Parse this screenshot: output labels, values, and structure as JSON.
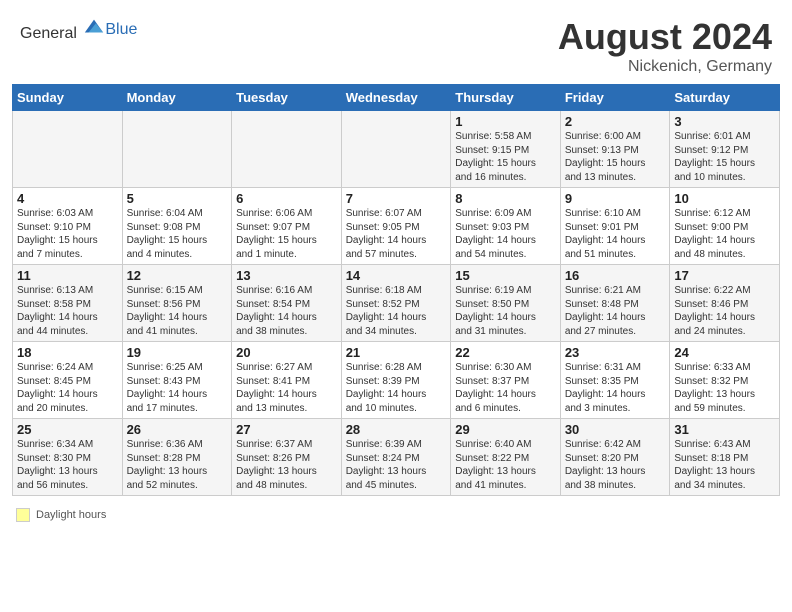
{
  "header": {
    "logo_general": "General",
    "logo_blue": "Blue",
    "month_year": "August 2024",
    "location": "Nickenich, Germany"
  },
  "footer": {
    "label": "Daylight hours"
  },
  "days_of_week": [
    "Sunday",
    "Monday",
    "Tuesday",
    "Wednesday",
    "Thursday",
    "Friday",
    "Saturday"
  ],
  "weeks": [
    [
      {
        "num": "",
        "info": ""
      },
      {
        "num": "",
        "info": ""
      },
      {
        "num": "",
        "info": ""
      },
      {
        "num": "",
        "info": ""
      },
      {
        "num": "1",
        "info": "Sunrise: 5:58 AM\nSunset: 9:15 PM\nDaylight: 15 hours\nand 16 minutes."
      },
      {
        "num": "2",
        "info": "Sunrise: 6:00 AM\nSunset: 9:13 PM\nDaylight: 15 hours\nand 13 minutes."
      },
      {
        "num": "3",
        "info": "Sunrise: 6:01 AM\nSunset: 9:12 PM\nDaylight: 15 hours\nand 10 minutes."
      }
    ],
    [
      {
        "num": "4",
        "info": "Sunrise: 6:03 AM\nSunset: 9:10 PM\nDaylight: 15 hours\nand 7 minutes."
      },
      {
        "num": "5",
        "info": "Sunrise: 6:04 AM\nSunset: 9:08 PM\nDaylight: 15 hours\nand 4 minutes."
      },
      {
        "num": "6",
        "info": "Sunrise: 6:06 AM\nSunset: 9:07 PM\nDaylight: 15 hours\nand 1 minute."
      },
      {
        "num": "7",
        "info": "Sunrise: 6:07 AM\nSunset: 9:05 PM\nDaylight: 14 hours\nand 57 minutes."
      },
      {
        "num": "8",
        "info": "Sunrise: 6:09 AM\nSunset: 9:03 PM\nDaylight: 14 hours\nand 54 minutes."
      },
      {
        "num": "9",
        "info": "Sunrise: 6:10 AM\nSunset: 9:01 PM\nDaylight: 14 hours\nand 51 minutes."
      },
      {
        "num": "10",
        "info": "Sunrise: 6:12 AM\nSunset: 9:00 PM\nDaylight: 14 hours\nand 48 minutes."
      }
    ],
    [
      {
        "num": "11",
        "info": "Sunrise: 6:13 AM\nSunset: 8:58 PM\nDaylight: 14 hours\nand 44 minutes."
      },
      {
        "num": "12",
        "info": "Sunrise: 6:15 AM\nSunset: 8:56 PM\nDaylight: 14 hours\nand 41 minutes."
      },
      {
        "num": "13",
        "info": "Sunrise: 6:16 AM\nSunset: 8:54 PM\nDaylight: 14 hours\nand 38 minutes."
      },
      {
        "num": "14",
        "info": "Sunrise: 6:18 AM\nSunset: 8:52 PM\nDaylight: 14 hours\nand 34 minutes."
      },
      {
        "num": "15",
        "info": "Sunrise: 6:19 AM\nSunset: 8:50 PM\nDaylight: 14 hours\nand 31 minutes."
      },
      {
        "num": "16",
        "info": "Sunrise: 6:21 AM\nSunset: 8:48 PM\nDaylight: 14 hours\nand 27 minutes."
      },
      {
        "num": "17",
        "info": "Sunrise: 6:22 AM\nSunset: 8:46 PM\nDaylight: 14 hours\nand 24 minutes."
      }
    ],
    [
      {
        "num": "18",
        "info": "Sunrise: 6:24 AM\nSunset: 8:45 PM\nDaylight: 14 hours\nand 20 minutes."
      },
      {
        "num": "19",
        "info": "Sunrise: 6:25 AM\nSunset: 8:43 PM\nDaylight: 14 hours\nand 17 minutes."
      },
      {
        "num": "20",
        "info": "Sunrise: 6:27 AM\nSunset: 8:41 PM\nDaylight: 14 hours\nand 13 minutes."
      },
      {
        "num": "21",
        "info": "Sunrise: 6:28 AM\nSunset: 8:39 PM\nDaylight: 14 hours\nand 10 minutes."
      },
      {
        "num": "22",
        "info": "Sunrise: 6:30 AM\nSunset: 8:37 PM\nDaylight: 14 hours\nand 6 minutes."
      },
      {
        "num": "23",
        "info": "Sunrise: 6:31 AM\nSunset: 8:35 PM\nDaylight: 14 hours\nand 3 minutes."
      },
      {
        "num": "24",
        "info": "Sunrise: 6:33 AM\nSunset: 8:32 PM\nDaylight: 13 hours\nand 59 minutes."
      }
    ],
    [
      {
        "num": "25",
        "info": "Sunrise: 6:34 AM\nSunset: 8:30 PM\nDaylight: 13 hours\nand 56 minutes."
      },
      {
        "num": "26",
        "info": "Sunrise: 6:36 AM\nSunset: 8:28 PM\nDaylight: 13 hours\nand 52 minutes."
      },
      {
        "num": "27",
        "info": "Sunrise: 6:37 AM\nSunset: 8:26 PM\nDaylight: 13 hours\nand 48 minutes."
      },
      {
        "num": "28",
        "info": "Sunrise: 6:39 AM\nSunset: 8:24 PM\nDaylight: 13 hours\nand 45 minutes."
      },
      {
        "num": "29",
        "info": "Sunrise: 6:40 AM\nSunset: 8:22 PM\nDaylight: 13 hours\nand 41 minutes."
      },
      {
        "num": "30",
        "info": "Sunrise: 6:42 AM\nSunset: 8:20 PM\nDaylight: 13 hours\nand 38 minutes."
      },
      {
        "num": "31",
        "info": "Sunrise: 6:43 AM\nSunset: 8:18 PM\nDaylight: 13 hours\nand 34 minutes."
      }
    ]
  ]
}
